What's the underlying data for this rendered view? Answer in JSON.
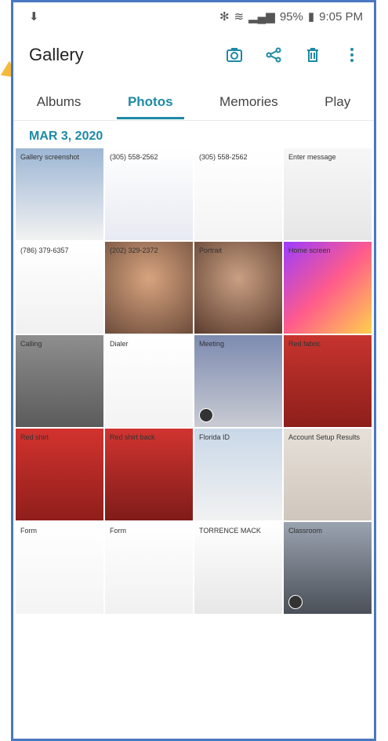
{
  "status": {
    "left_icon": "download-done-icon",
    "bluetooth_icon": "bluetooth-icon",
    "wifi_icon": "wifi-icon",
    "signal_icon": "signal-icon",
    "battery_text": "95%",
    "battery_icon": "battery-icon",
    "time": "9:05 PM"
  },
  "appbar": {
    "title": "Gallery",
    "camera_icon": "camera-icon",
    "share_icon": "share-icon",
    "delete_icon": "trash-icon",
    "more_icon": "more-vertical-icon"
  },
  "tabs": [
    {
      "label": "Albums",
      "active": false
    },
    {
      "label": "Photos",
      "active": true
    },
    {
      "label": "Memories",
      "active": false
    },
    {
      "label": "Play",
      "active": false
    }
  ],
  "section": {
    "date": "MAR 3, 2020"
  },
  "thumbnails": [
    {
      "label": "Gallery screenshot"
    },
    {
      "label": "(305) 558-2562"
    },
    {
      "label": "(305) 558-2562"
    },
    {
      "label": "Enter message"
    },
    {
      "label": "(786) 379-6357"
    },
    {
      "label": "(202) 329-2372"
    },
    {
      "label": "Portrait"
    },
    {
      "label": "Home screen"
    },
    {
      "label": "Calling"
    },
    {
      "label": "Dialer"
    },
    {
      "label": "Meeting"
    },
    {
      "label": "Red fabric"
    },
    {
      "label": "Red shirt"
    },
    {
      "label": "Red shirt back"
    },
    {
      "label": "Florida ID"
    },
    {
      "label": "Account Setup Results"
    },
    {
      "label": "Form"
    },
    {
      "label": "Form"
    },
    {
      "label": "TORRENCE MACK"
    },
    {
      "label": "Classroom"
    }
  ],
  "colors": {
    "accent": "#1e8aa5",
    "frame": "#4a78c2",
    "arrow": "#f6b93b"
  }
}
